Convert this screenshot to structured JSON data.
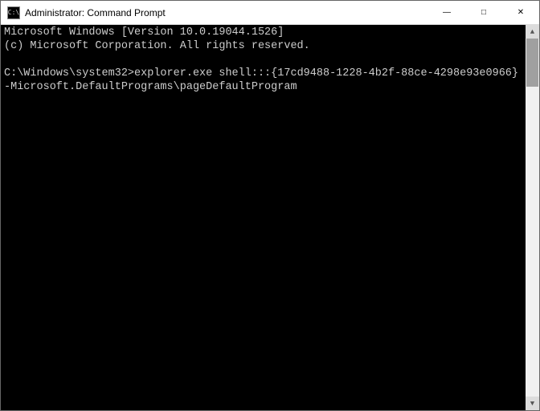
{
  "titlebar": {
    "icon_label": "C:\\",
    "title": "Administrator: Command Prompt"
  },
  "window_controls": {
    "minimize": "—",
    "maximize": "□",
    "close": "✕"
  },
  "terminal": {
    "line1": "Microsoft Windows [Version 10.0.19044.1526]",
    "line2": "(c) Microsoft Corporation. All rights reserved.",
    "blank": "",
    "prompt": "C:\\Windows\\system32>",
    "command": "explorer.exe shell:::{17cd9488-1228-4b2f-88ce-4298e93e0966} -Microsoft.DefaultPrograms\\pageDefaultProgram"
  },
  "scrollbar": {
    "up": "▲",
    "down": "▼"
  }
}
